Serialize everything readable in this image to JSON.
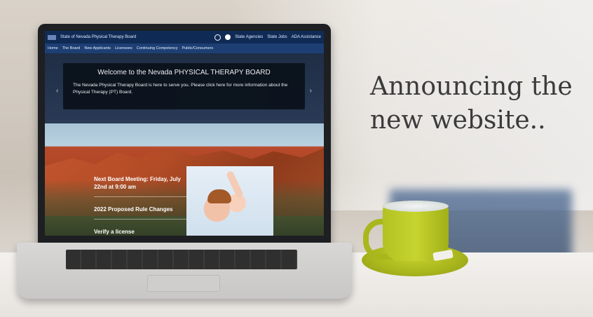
{
  "topbar": {
    "site_title": "State of Nevada Physical Therapy Board",
    "links": [
      "State Agencies",
      "State Jobs",
      "ADA Assistance"
    ]
  },
  "navbar": {
    "items": [
      "Home",
      "The Board",
      "New Applicants",
      "Licensees",
      "Continuing Competency",
      "Public/Consumers"
    ]
  },
  "hero": {
    "title": "Welcome to the Nevada PHYSICAL THERAPY BOARD",
    "text": "The Nevada Physical Therapy Board is here to serve you. Please click here for more information about the Physical Therapy (PT) Board.",
    "left_arrow": "‹",
    "right_arrow": "›"
  },
  "content": {
    "links": [
      "Next Board Meeting: Friday, July 22nd at 9:00 am",
      "2022 Proposed Rule Changes",
      "Verify a license"
    ]
  },
  "headline": "Announcing the new website.."
}
